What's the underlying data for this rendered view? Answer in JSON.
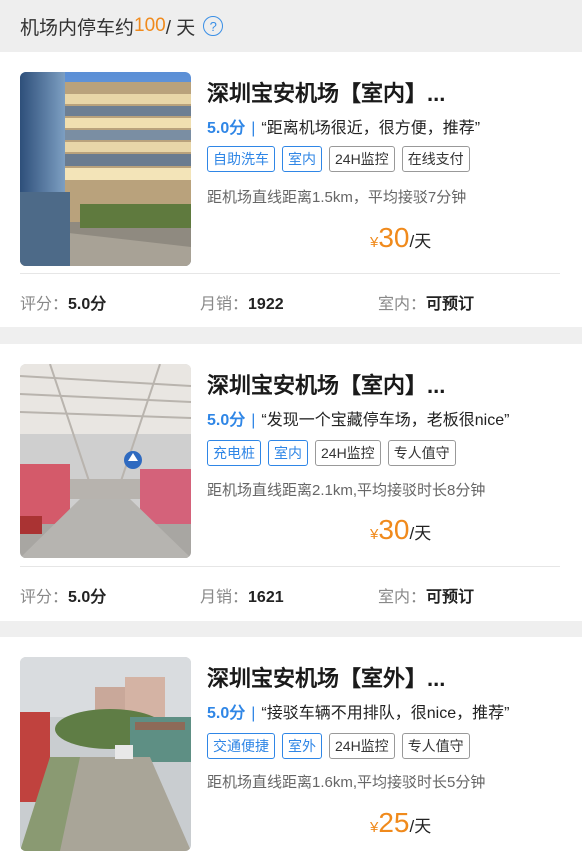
{
  "header": {
    "prefix": "机场内停车约",
    "count": "100",
    "suffix": " / 天",
    "help_glyph": "?"
  },
  "lots": [
    {
      "title": "深圳宝安机场【室内】...",
      "score": "5.0分",
      "quote": "“距离机场很近，很方便，推荐”",
      "tags": [
        {
          "label": "自助洗车",
          "style": "blue"
        },
        {
          "label": "室内",
          "style": "blue"
        },
        {
          "label": "24H监控",
          "style": "gray"
        },
        {
          "label": "在线支付",
          "style": "gray"
        }
      ],
      "distance": "距机场直线距离1.5km，平均接驳7分钟",
      "price_currency": "¥",
      "price": "30",
      "price_unit": "/天",
      "stats": {
        "rating_label": "评分：",
        "rating": "5.0分",
        "sales_label": "月销：",
        "sales": "1922",
        "type_label": "室内：",
        "booking": "可预订"
      }
    },
    {
      "title": "深圳宝安机场【室内】...",
      "score": "5.0分",
      "quote": "“发现一个宝藏停车场，老板很nice”",
      "tags": [
        {
          "label": "充电桩",
          "style": "blue"
        },
        {
          "label": "室内",
          "style": "blue"
        },
        {
          "label": "24H监控",
          "style": "gray"
        },
        {
          "label": "专人值守",
          "style": "gray"
        }
      ],
      "distance": "距机场直线距离2.1km,平均接驳时长8分钟",
      "price_currency": "¥",
      "price": "30",
      "price_unit": "/天",
      "stats": {
        "rating_label": "评分：",
        "rating": "5.0分",
        "sales_label": "月销：",
        "sales": "1621",
        "type_label": "室内：",
        "booking": "可预订"
      }
    },
    {
      "title": "深圳宝安机场【室外】...",
      "score": "5.0分",
      "quote": "“接驳车辆不用排队，很nice，推荐”",
      "tags": [
        {
          "label": "交通便捷",
          "style": "blue"
        },
        {
          "label": "室外",
          "style": "blue"
        },
        {
          "label": "24H监控",
          "style": "gray"
        },
        {
          "label": "专人值守",
          "style": "gray"
        }
      ],
      "distance": "距机场直线距离1.6km,平均接驳时长5分钟",
      "price_currency": "¥",
      "price": "25",
      "price_unit": "/天"
    }
  ],
  "colors": {
    "accent_orange": "#f08a1c",
    "accent_blue": "#2f86e6"
  }
}
